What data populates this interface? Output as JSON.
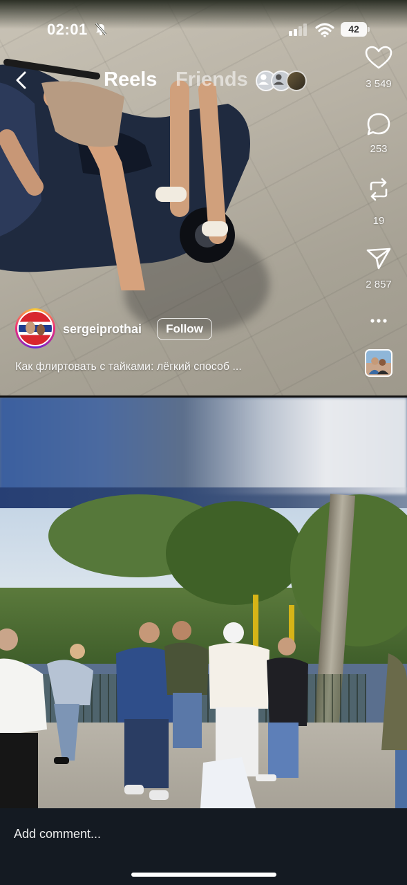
{
  "status_bar": {
    "time": "02:01",
    "battery": "42",
    "silent_mode": true
  },
  "header": {
    "tabs": [
      {
        "label": "Reels",
        "active": true
      },
      {
        "label": "Friends",
        "active": false
      }
    ]
  },
  "reel": {
    "author": {
      "username": "sergeiprothai",
      "follow_label": "Follow"
    },
    "caption": "Как флиртовать с тайками: лёгкий способ ...",
    "actions": [
      {
        "icon": "heart-icon",
        "count": "3 549"
      },
      {
        "icon": "comment-icon",
        "count": "253"
      },
      {
        "icon": "repost-icon",
        "count": "19"
      },
      {
        "icon": "send-icon",
        "count": "2 857"
      },
      {
        "icon": "more-icon",
        "count": ""
      }
    ]
  },
  "comment_bar": {
    "placeholder": "Add comment..."
  },
  "colors": {
    "comment_bar_bg": "#141a22",
    "story_ring": [
      "#f9ce34",
      "#ee2a7b",
      "#6228d7"
    ]
  }
}
